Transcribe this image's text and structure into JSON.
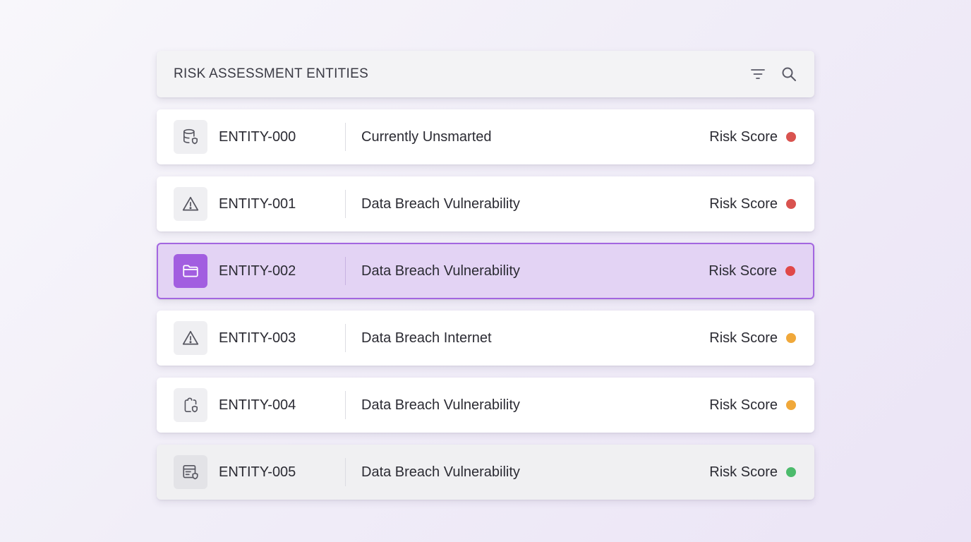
{
  "header": {
    "title": "RISK ASSESSMENT ENTITIES",
    "filter_icon": "filter-icon",
    "search_icon": "search-icon"
  },
  "colors": {
    "accent": "#a366e0",
    "risk_high": "#d9534f",
    "risk_medium": "#f0a83a",
    "risk_low": "#4cbb6c"
  },
  "rows": [
    {
      "id": "ENTITY-000",
      "description": "Currently Unsmarted",
      "score_label": "Risk Score",
      "icon": "database-shield-icon",
      "risk": "high"
    },
    {
      "id": "ENTITY-001",
      "description": "Data Breach Vulnerability",
      "score_label": "Risk Score",
      "icon": "warning-icon",
      "risk": "high"
    },
    {
      "id": "ENTITY-002",
      "description": "Data Breach Vulnerability",
      "score_label": "Risk Score",
      "icon": "folder-icon",
      "risk": "high",
      "selected": true
    },
    {
      "id": "ENTITY-003",
      "description": "Data Breach Internet",
      "score_label": "Risk Score",
      "icon": "warning-icon",
      "risk": "medium"
    },
    {
      "id": "ENTITY-004",
      "description": "Data Breach Vulnerability",
      "score_label": "Risk Score",
      "icon": "document-shield-icon",
      "risk": "medium"
    },
    {
      "id": "ENTITY-005",
      "description": "Data Breach Vulnerability",
      "score_label": "Risk Score",
      "icon": "server-shield-icon",
      "risk": "low"
    }
  ]
}
